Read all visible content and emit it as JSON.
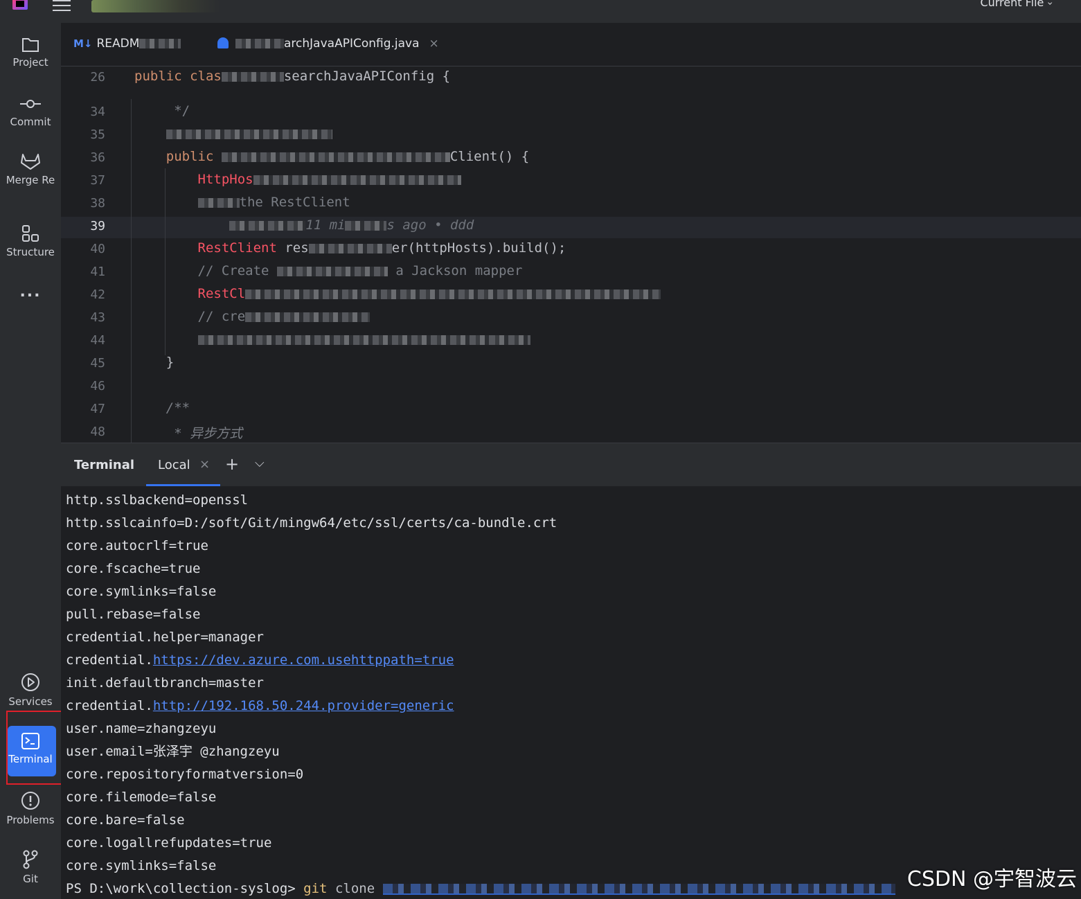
{
  "titlebar": {
    "run_config_label": "Current File"
  },
  "toolstrip": {
    "items": [
      {
        "label": "Project"
      },
      {
        "label": "Commit"
      },
      {
        "label": "Merge Re"
      },
      {
        "label": "Structure"
      },
      {
        "label": "..."
      },
      {
        "label": "Services"
      },
      {
        "label": "Terminal"
      },
      {
        "label": "Problems"
      },
      {
        "label": "Git"
      }
    ],
    "active": "Terminal",
    "highlight_color": "#e0202a"
  },
  "editor": {
    "tabs": [
      {
        "icon": "markdown-icon",
        "prefix": "M↓",
        "label": "READM"
      },
      {
        "icon": "java-class-icon",
        "label": "archJavaAPIConfig.java"
      }
    ],
    "lines": [
      {
        "n": "26",
        "segments": [
          {
            "t": "public ",
            "c": "kw"
          },
          {
            "t": "clas",
            "c": "kw"
          },
          {
            "t": "",
            "c": "blur"
          },
          {
            "t": "searchJavaAPIConfig {",
            "c": ""
          }
        ]
      },
      {
        "n": "34",
        "segments": [
          {
            "t": " */",
            "c": "cm2"
          }
        ]
      },
      {
        "n": "35",
        "segments": [
          {
            "t": "",
            "c": "blur"
          }
        ]
      },
      {
        "n": "36",
        "segments": [
          {
            "t": "public ",
            "c": "kw"
          },
          {
            "t": "",
            "c": "blur"
          },
          {
            "t": "Client() {",
            "c": ""
          }
        ]
      },
      {
        "n": "37",
        "segments": [
          {
            "t": "    HttpHos",
            "c": "cls"
          },
          {
            "t": "",
            "c": "blur"
          }
        ]
      },
      {
        "n": "38",
        "segments": [
          {
            "t": "    ",
            "c": ""
          },
          {
            "t": "",
            "c": "blur"
          },
          {
            "t": "the RestClient",
            "c": "cm2"
          }
        ]
      },
      {
        "n": "39",
        "segments": [
          {
            "t": "        ",
            "c": ""
          },
          {
            "t": "",
            "c": "blur"
          },
          {
            "t": "11 mi",
            "c": "inlay"
          },
          {
            "t": "",
            "c": "blur"
          },
          {
            "t": "s ago • ddd",
            "c": "inlay"
          }
        ]
      },
      {
        "n": "40",
        "segments": [
          {
            "t": "    RestClient ",
            "c": "cls"
          },
          {
            "t": "res",
            "c": ""
          },
          {
            "t": "",
            "c": "blur"
          },
          {
            "t": "er(httpHosts).build();",
            "c": ""
          }
        ]
      },
      {
        "n": "41",
        "segments": [
          {
            "t": "    // Create ",
            "c": "cm2"
          },
          {
            "t": "",
            "c": "blur"
          },
          {
            "t": " a Jackson mapper",
            "c": "cm2"
          }
        ]
      },
      {
        "n": "42",
        "segments": [
          {
            "t": "    RestCl",
            "c": "cls"
          },
          {
            "t": "",
            "c": "blur"
          }
        ]
      },
      {
        "n": "43",
        "segments": [
          {
            "t": "    // cre",
            "c": "cm2"
          },
          {
            "t": "",
            "c": "blur"
          }
        ]
      },
      {
        "n": "44",
        "segments": [
          {
            "t": "    ",
            "c": ""
          },
          {
            "t": "",
            "c": "blur"
          }
        ]
      },
      {
        "n": "45",
        "segments": [
          {
            "t": "}",
            "c": ""
          }
        ]
      },
      {
        "n": "46",
        "segments": []
      },
      {
        "n": "47",
        "segments": [
          {
            "t": "/**",
            "c": "cm"
          }
        ]
      },
      {
        "n": "48",
        "segments": [
          {
            "t": " * 异步方式",
            "c": "cm"
          }
        ]
      }
    ]
  },
  "terminal": {
    "title": "Terminal",
    "tab_label": "Local",
    "lines": [
      {
        "text": "http.sslbackend=openssl"
      },
      {
        "text": "http.sslcainfo=D:/soft/Git/mingw64/etc/ssl/certs/ca-bundle.crt"
      },
      {
        "text": "core.autocrlf=true"
      },
      {
        "text": "core.fscache=true"
      },
      {
        "text": "core.symlinks=false"
      },
      {
        "text": "pull.rebase=false"
      },
      {
        "text": "credential.helper=manager"
      },
      {
        "text": "credential.",
        "link": "https://dev.azure.com.usehttppath=true"
      },
      {
        "text": "init.defaultbranch=master"
      },
      {
        "text": "credential.",
        "link": "http://192.168.50.244.provider=generic"
      },
      {
        "text": "user.name=zhangzeyu"
      },
      {
        "text": "user.email=张泽宇 @zhangzeyu"
      },
      {
        "text": "core.repositoryformatversion=0"
      },
      {
        "text": "core.filemode=false"
      },
      {
        "text": "core.bare=false"
      },
      {
        "text": "core.logallrefupdates=true"
      },
      {
        "text": "core.symlinks=false"
      }
    ],
    "prompt": "PS D:\\work\\collection-syslog>",
    "prompt_command": "git",
    "prompt_args": "clone"
  },
  "watermark": "CSDN @宇智波云"
}
